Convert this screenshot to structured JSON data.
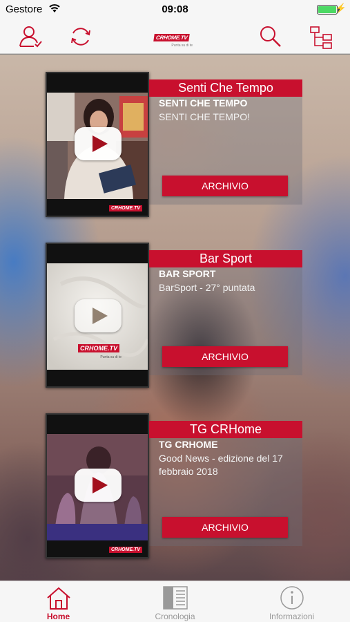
{
  "status": {
    "carrier": "Gestore",
    "time": "09:08",
    "battery_level": 1.0
  },
  "header": {
    "logo_text": "CRHOME.TV",
    "logo_tagline": "Punta su di te"
  },
  "colors": {
    "accent": "#c8102e"
  },
  "programs": [
    {
      "title": "Senti Che Tempo",
      "subtitle": "SENTI CHE TEMPO",
      "description": "SENTI CHE TEMPO!",
      "button": "ARCHIVIO",
      "thumb_brand": "CRHOME.TV"
    },
    {
      "title": "Bar Sport",
      "subtitle": "BAR SPORT",
      "description": "BarSport - 27° puntata",
      "button": "ARCHIVIO",
      "thumb_brand": "CRHOME.TV",
      "thumb_center_logo": "CRHOME.TV",
      "thumb_center_tagline": "Punta su di te"
    },
    {
      "title": "TG CRHome",
      "subtitle": "TG CRHOME",
      "description": "Good News - edizione del 17 febbraio 2018",
      "button": "ARCHIVIO",
      "thumb_brand": "CRHOME.TV"
    }
  ],
  "tabs": [
    {
      "label": "Home",
      "active": true
    },
    {
      "label": "Cronologia",
      "active": false
    },
    {
      "label": "Informazioni",
      "active": false
    }
  ]
}
